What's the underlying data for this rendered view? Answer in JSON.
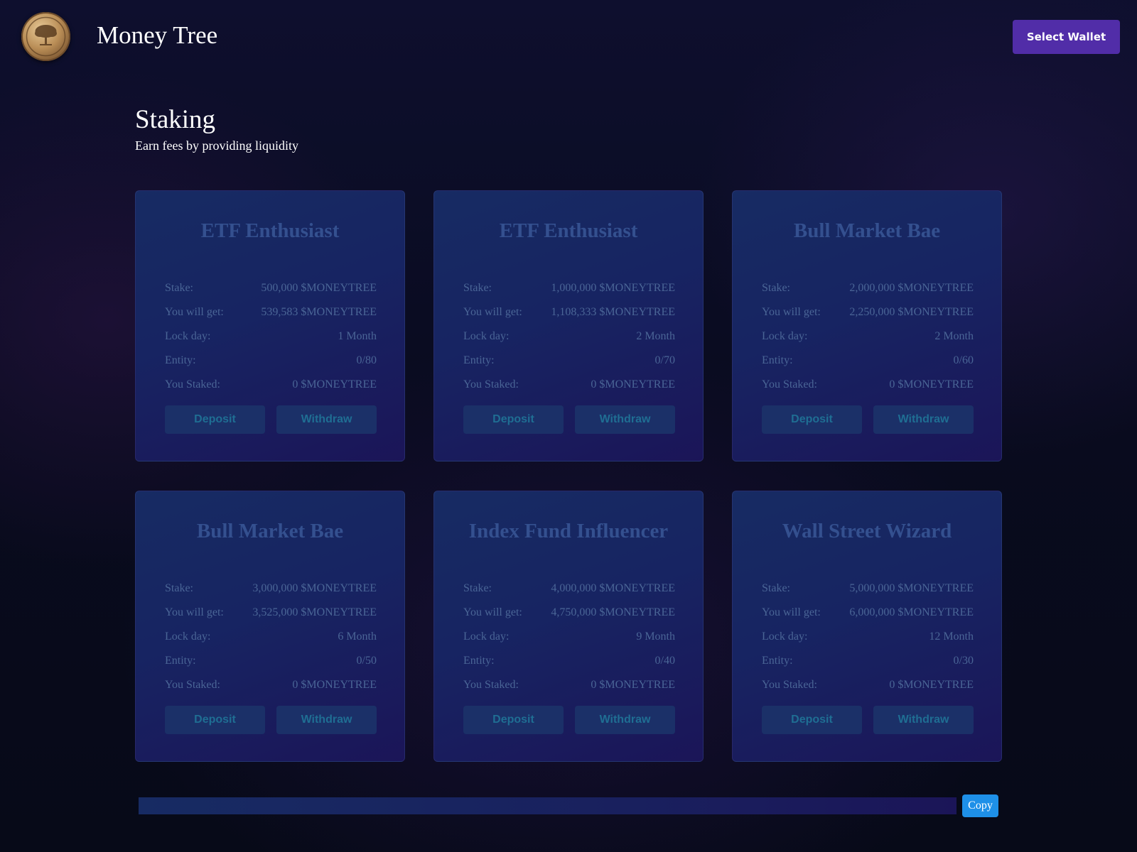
{
  "header": {
    "brand": "Money Tree",
    "select_wallet_label": "Select Wallet"
  },
  "page": {
    "title": "Staking",
    "subtitle": "Earn fees by providing liquidity"
  },
  "labels": {
    "stake": "Stake:",
    "you_will_get": "You will get:",
    "lock_day": "Lock day:",
    "entity": "Entity:",
    "you_staked": "You Staked:",
    "deposit": "Deposit",
    "withdraw": "Withdraw"
  },
  "cards": [
    {
      "title": "ETF Enthusiast",
      "stake": "500,000 $MONEYTREE",
      "you_will_get": "539,583 $MONEYTREE",
      "lock_day": "1 Month",
      "entity": "0/80",
      "you_staked": "0 $MONEYTREE"
    },
    {
      "title": "ETF Enthusiast",
      "stake": "1,000,000 $MONEYTREE",
      "you_will_get": "1,108,333 $MONEYTREE",
      "lock_day": "2 Month",
      "entity": "0/70",
      "you_staked": "0 $MONEYTREE"
    },
    {
      "title": "Bull Market Bae",
      "stake": "2,000,000 $MONEYTREE",
      "you_will_get": "2,250,000 $MONEYTREE",
      "lock_day": "2 Month",
      "entity": "0/60",
      "you_staked": "0 $MONEYTREE"
    },
    {
      "title": "Bull Market Bae",
      "stake": "3,000,000 $MONEYTREE",
      "you_will_get": "3,525,000 $MONEYTREE",
      "lock_day": "6 Month",
      "entity": "0/50",
      "you_staked": "0 $MONEYTREE"
    },
    {
      "title": "Index Fund Influencer",
      "stake": "4,000,000 $MONEYTREE",
      "you_will_get": "4,750,000 $MONEYTREE",
      "lock_day": "9 Month",
      "entity": "0/40",
      "you_staked": "0 $MONEYTREE"
    },
    {
      "title": "Wall Street Wizard",
      "stake": "5,000,000 $MONEYTREE",
      "you_will_get": "6,000,000 $MONEYTREE",
      "lock_day": "12 Month",
      "entity": "0/30",
      "you_staked": "0 $MONEYTREE"
    }
  ],
  "referral": {
    "value": "",
    "copy_label": "Copy"
  }
}
